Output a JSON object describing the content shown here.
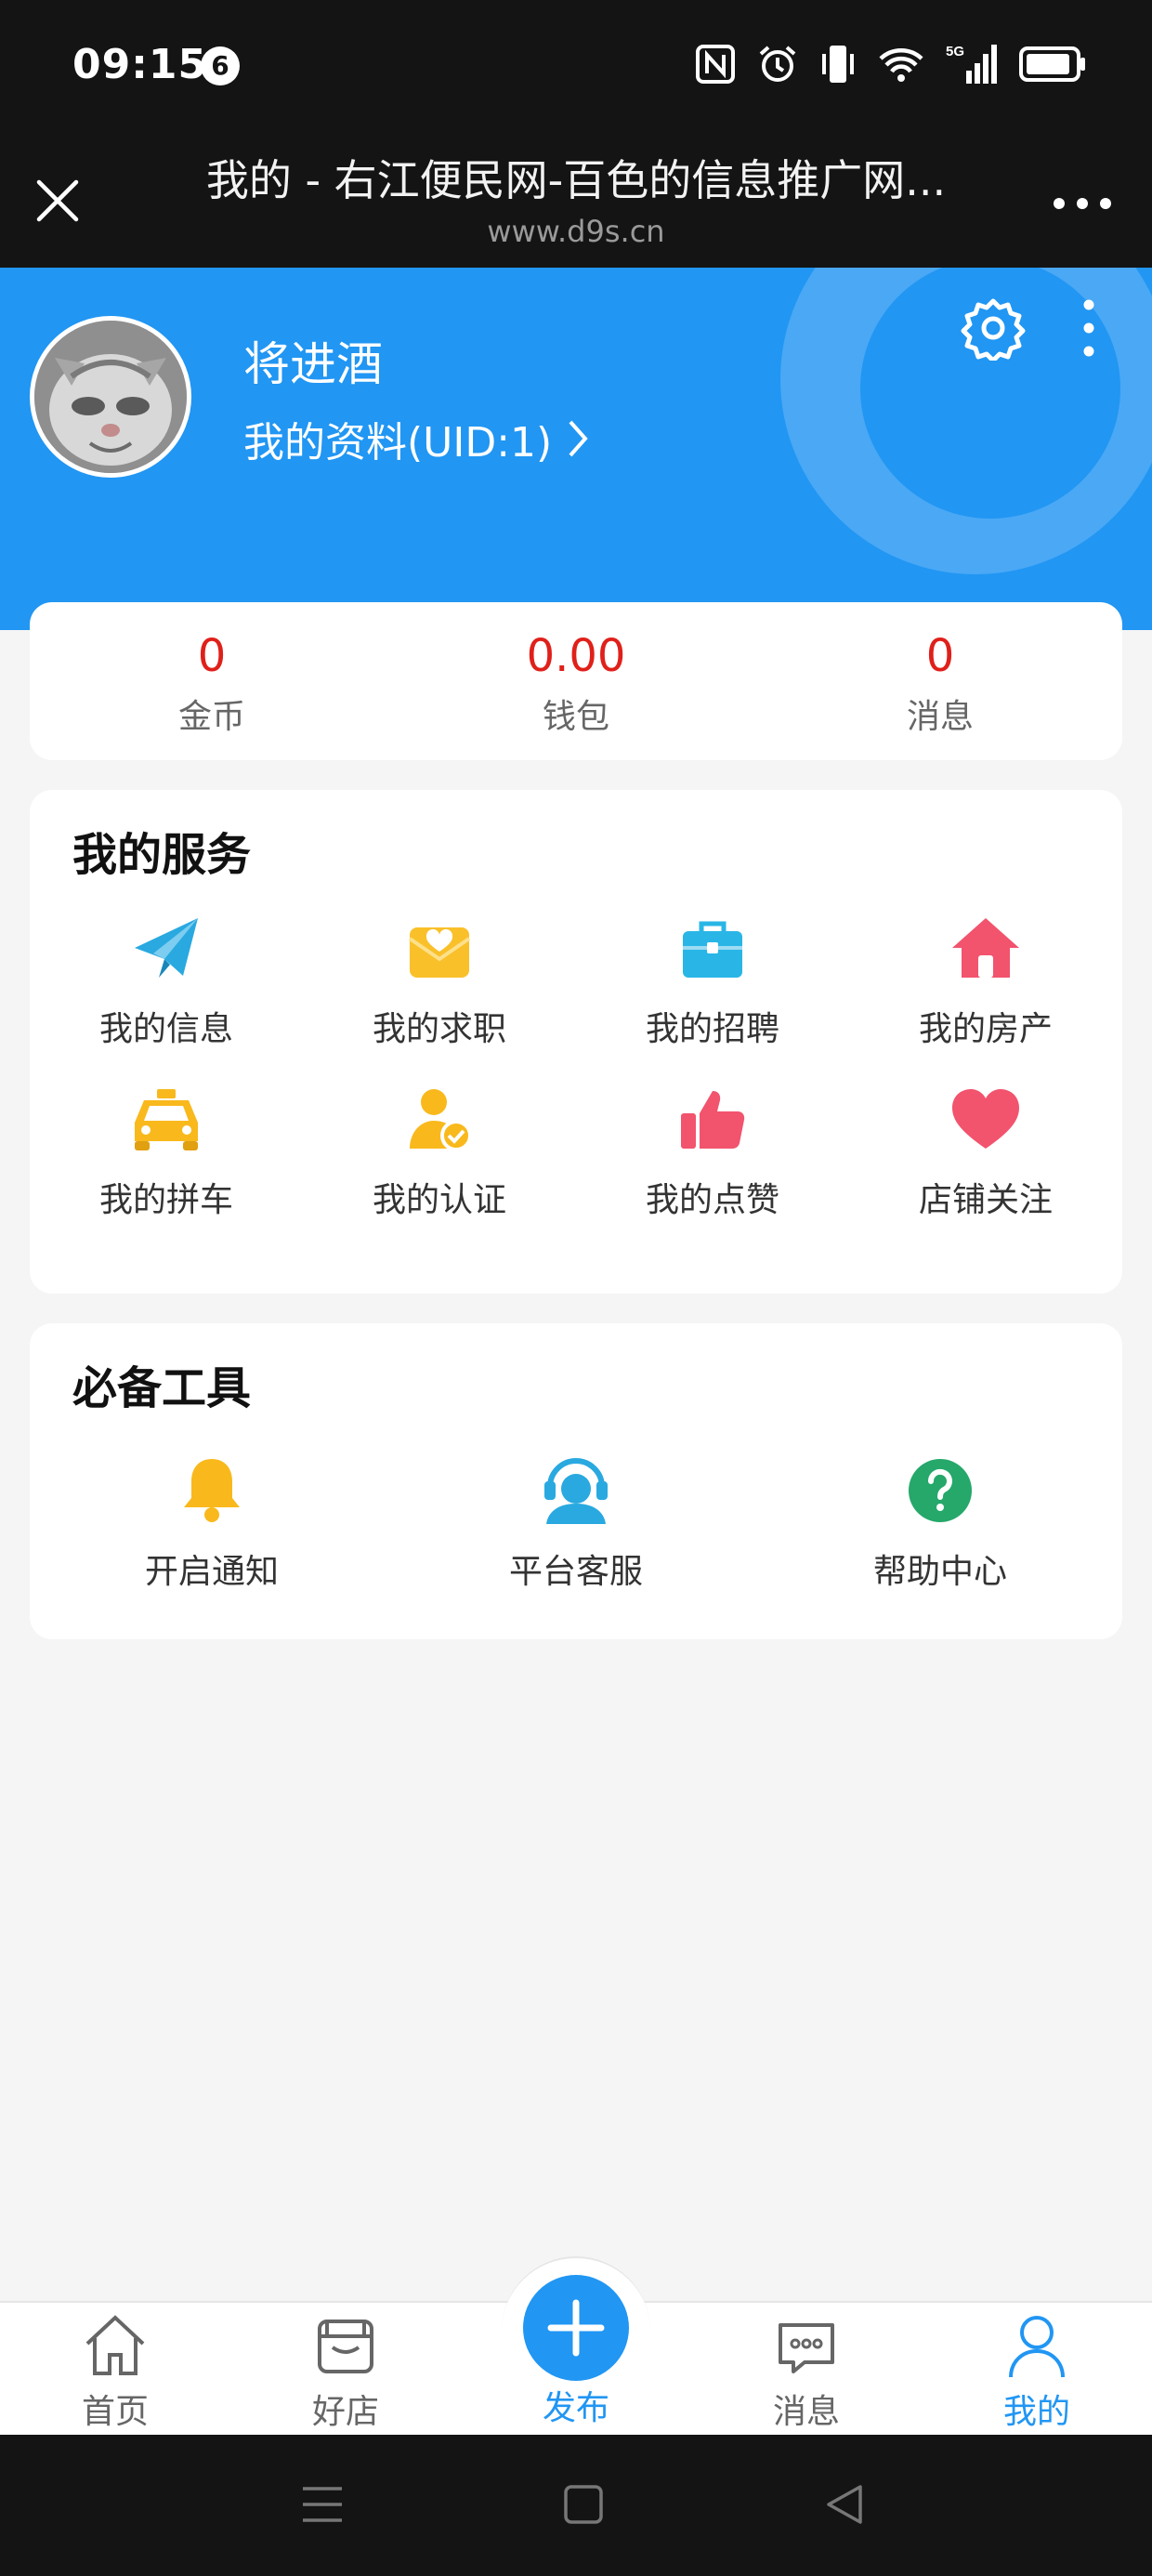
{
  "status_bar": {
    "time": "09:15",
    "notification_count": "6",
    "icons": [
      "nfc-icon",
      "alarm-icon",
      "vibrate-icon",
      "wifi-icon",
      "signal-5g-icon",
      "battery-icon"
    ]
  },
  "web_header": {
    "title": "我的 - 右江便民网-百色的信息推广网...",
    "url": "www.d9s.cn"
  },
  "profile": {
    "name": "将进酒",
    "profile_link": "我的资料(UID:1)"
  },
  "stats": [
    {
      "value": "0",
      "label": "金币"
    },
    {
      "value": "0.00",
      "label": "钱包"
    },
    {
      "value": "0",
      "label": "消息"
    }
  ],
  "services": {
    "title": "我的服务",
    "items": [
      {
        "label": "我的信息",
        "icon": "paper-plane-icon",
        "color": "#29a9e0"
      },
      {
        "label": "我的求职",
        "icon": "envelope-heart-icon",
        "color": "#f9c02a"
      },
      {
        "label": "我的招聘",
        "icon": "briefcase-icon",
        "color": "#29b6e6"
      },
      {
        "label": "我的房产",
        "icon": "house-icon",
        "color": "#f2536d"
      },
      {
        "label": "我的拼车",
        "icon": "taxi-icon",
        "color": "#f9b91c"
      },
      {
        "label": "我的认证",
        "icon": "user-verified-icon",
        "color": "#f9b91c"
      },
      {
        "label": "我的点赞",
        "icon": "thumbs-up-icon",
        "color": "#f2536d"
      },
      {
        "label": "店铺关注",
        "icon": "heart-icon",
        "color": "#f2536d"
      }
    ]
  },
  "tools": {
    "title": "必备工具",
    "items": [
      {
        "label": "开启通知",
        "icon": "bell-icon",
        "color": "#f9b91c"
      },
      {
        "label": "平台客服",
        "icon": "headset-agent-icon",
        "color": "#29a9e0"
      },
      {
        "label": "帮助中心",
        "icon": "help-circle-icon",
        "color": "#25a86a"
      }
    ]
  },
  "bottom_nav": {
    "items": [
      {
        "label": "首页",
        "icon": "home-icon"
      },
      {
        "label": "好店",
        "icon": "shop-icon"
      },
      {
        "label": "发布",
        "icon": "plus-icon"
      },
      {
        "label": "消息",
        "icon": "chat-icon"
      },
      {
        "label": "我的",
        "icon": "user-icon"
      }
    ],
    "active": "我的"
  },
  "colors": {
    "primary": "#2196f3",
    "stat_value": "#e0201a",
    "dark_bar": "#141414"
  }
}
